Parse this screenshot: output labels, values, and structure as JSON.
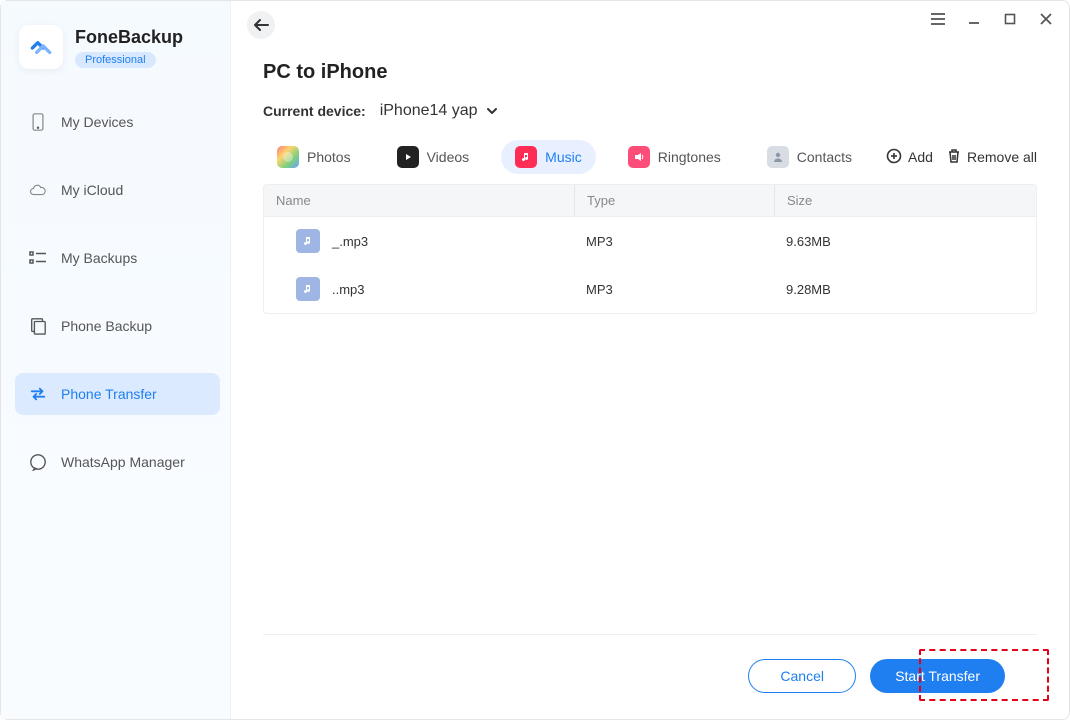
{
  "brand": {
    "name": "FoneBackup",
    "tier": "Professional"
  },
  "sidebar": {
    "items": [
      {
        "label": "My Devices"
      },
      {
        "label": "My iCloud"
      },
      {
        "label": "My Backups"
      },
      {
        "label": "Phone Backup"
      },
      {
        "label": "Phone Transfer"
      },
      {
        "label": "WhatsApp Manager"
      }
    ]
  },
  "page": {
    "title": "PC to iPhone",
    "current_device_label": "Current device:",
    "current_device": "iPhone14 yap"
  },
  "categories": [
    {
      "label": "Photos"
    },
    {
      "label": "Videos"
    },
    {
      "label": "Music"
    },
    {
      "label": "Ringtones"
    },
    {
      "label": "Contacts"
    }
  ],
  "toolbar": {
    "add": "Add",
    "remove_all": "Remove all"
  },
  "table": {
    "headers": {
      "name": "Name",
      "type": "Type",
      "size": "Size"
    },
    "rows": [
      {
        "name": "_.mp3",
        "type": "MP3",
        "size": "9.63MB"
      },
      {
        "name": "..mp3",
        "type": "MP3",
        "size": "9.28MB"
      }
    ]
  },
  "footer": {
    "cancel": "Cancel",
    "start": "Start Transfer"
  }
}
